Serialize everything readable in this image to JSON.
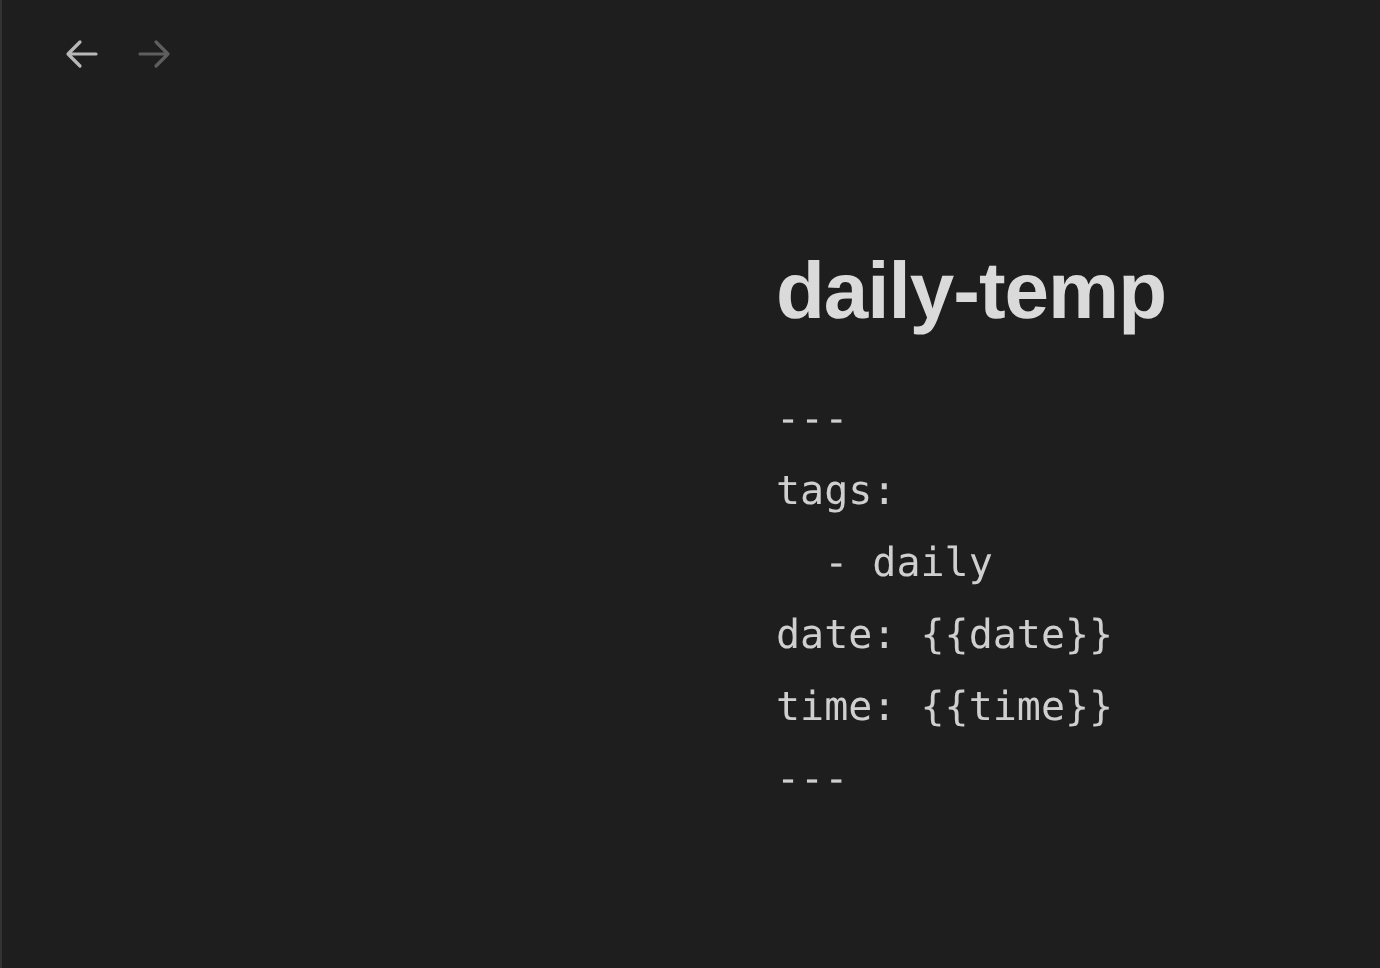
{
  "nav": [
    {
      "kind": "back",
      "disabled": false
    },
    {
      "kind": "forward",
      "disabled": true
    }
  ],
  "note": {
    "title": "daily-temp",
    "lines": [
      "---",
      "tags:",
      "  - daily",
      "date: {{date}}",
      "time: {{time}}",
      "---"
    ]
  }
}
